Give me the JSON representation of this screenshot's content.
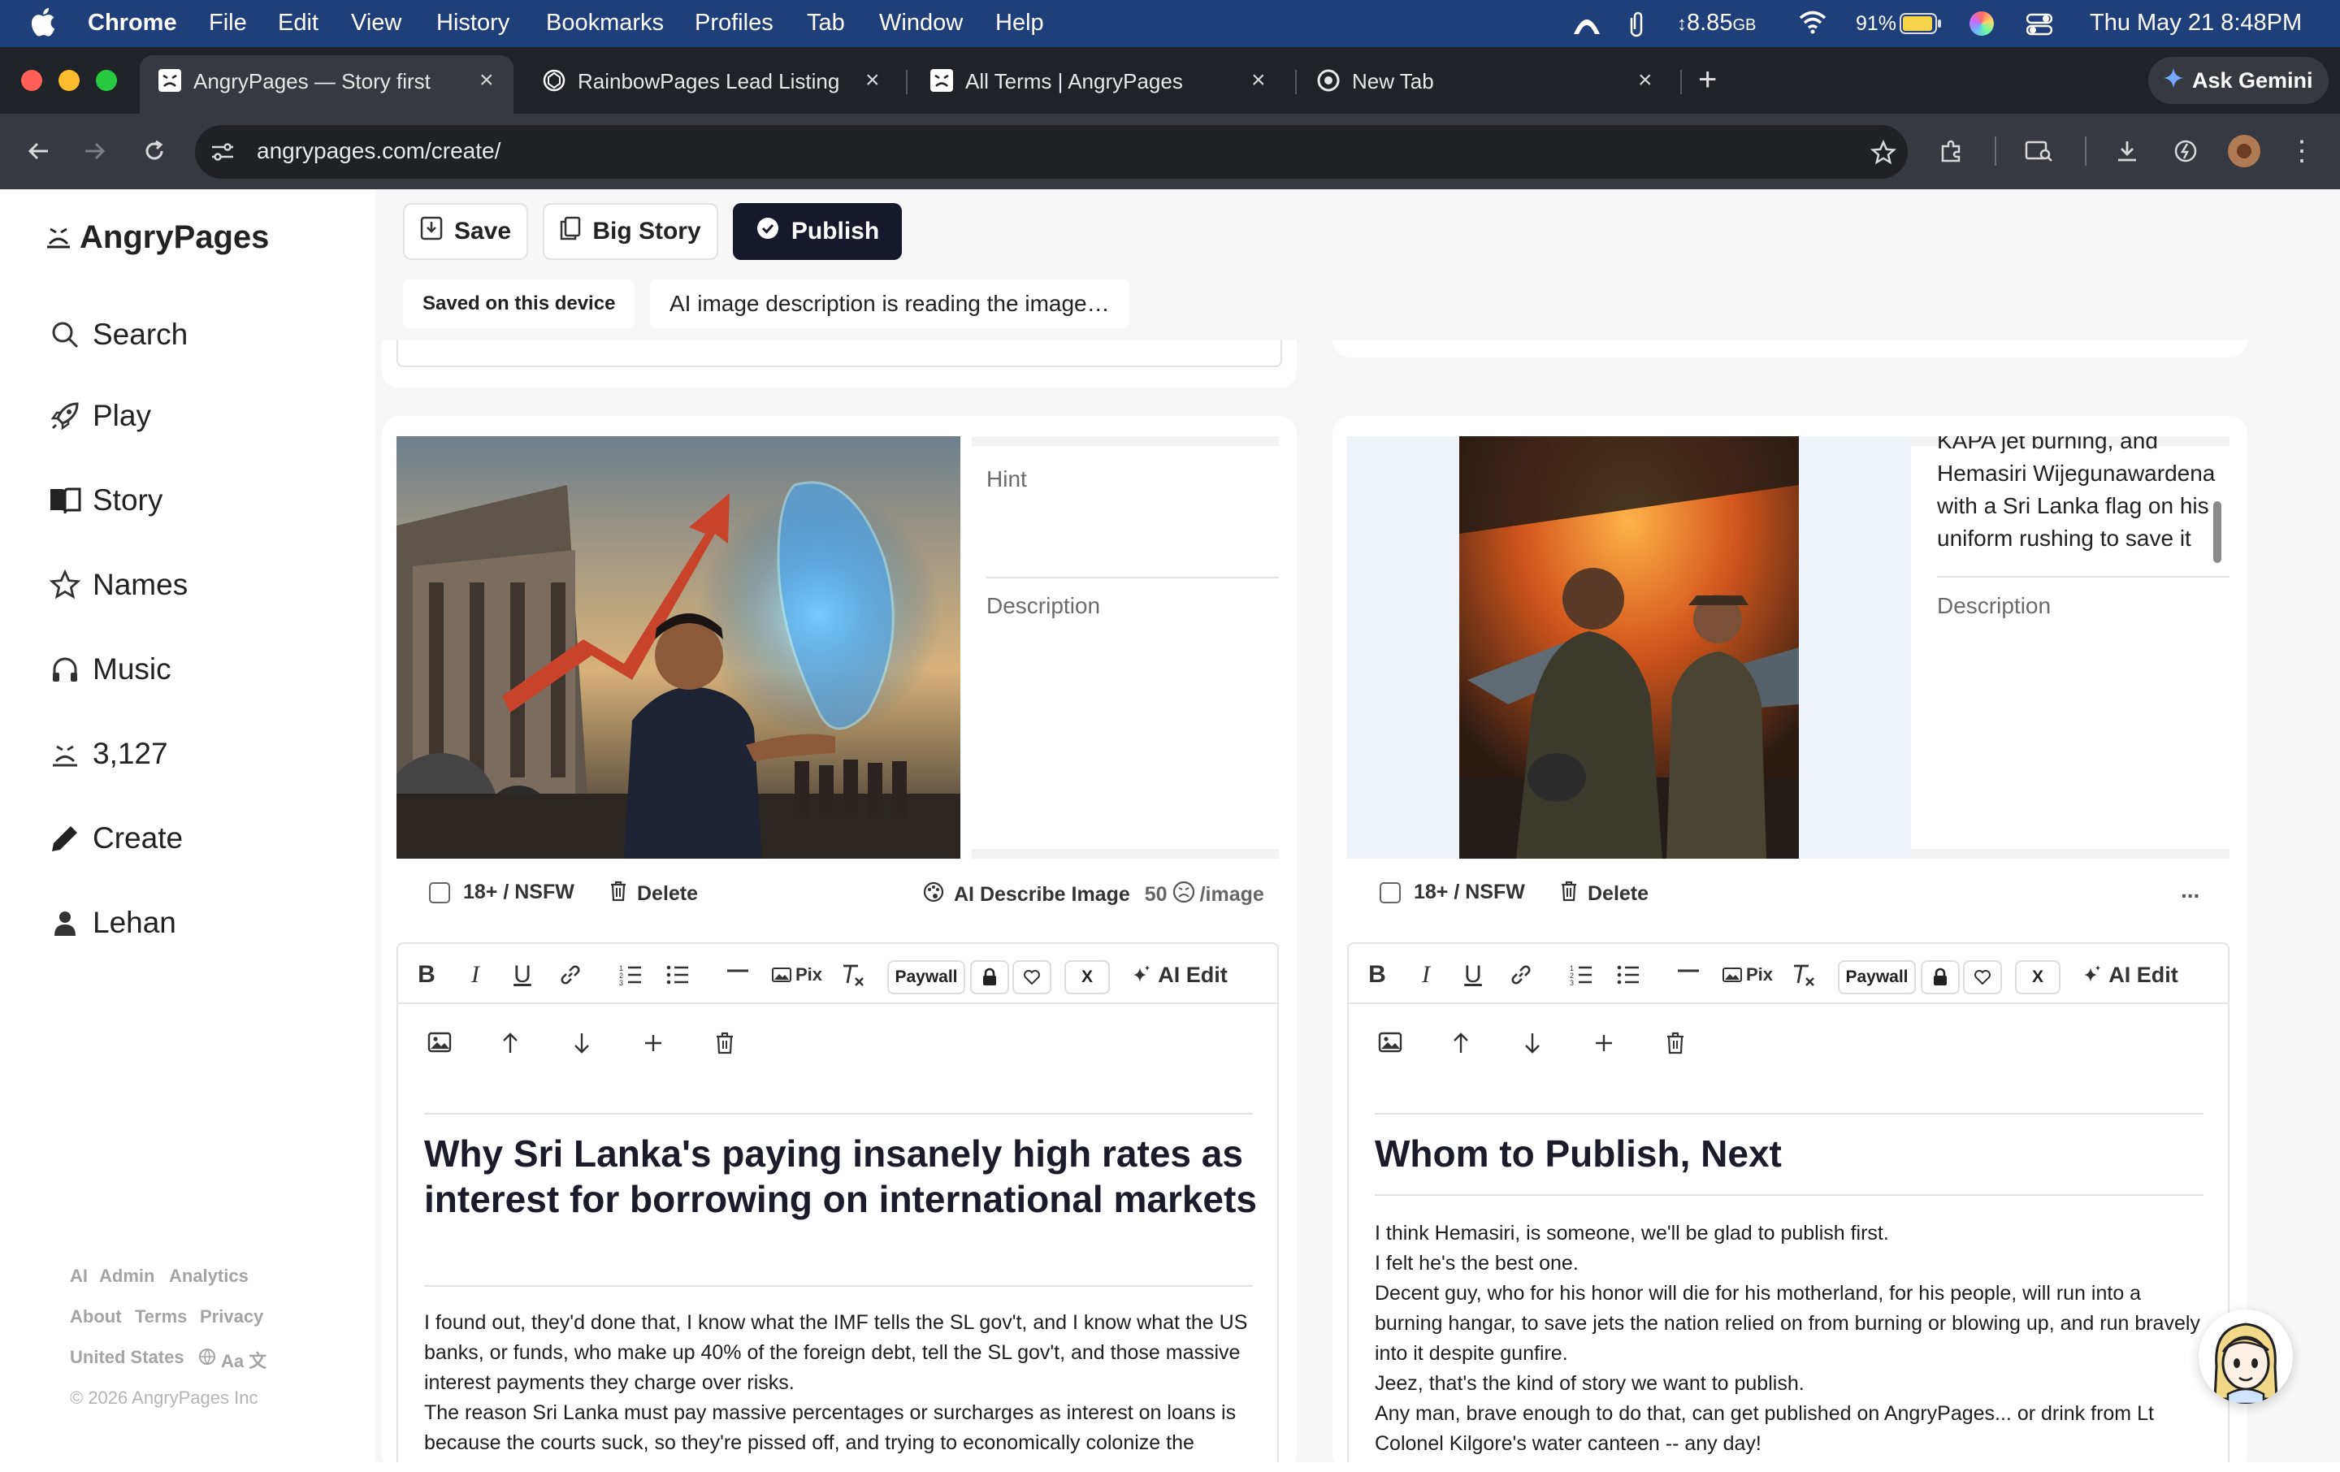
{
  "menubar": {
    "app": "Chrome",
    "items": [
      "File",
      "Edit",
      "View",
      "History",
      "Bookmarks",
      "Profiles",
      "Tab",
      "Window",
      "Help"
    ],
    "storage": "8.85",
    "storage_unit": "GB",
    "battery": "91%",
    "datetime": "Thu May 21  8:48PM"
  },
  "browser": {
    "tabs": [
      {
        "title": "AngryPages — Story first",
        "active": true
      },
      {
        "title": "RainbowPages Lead Listing",
        "active": false
      },
      {
        "title": "All Terms | AngryPages",
        "active": false
      },
      {
        "title": "New Tab",
        "active": false
      }
    ],
    "new_tab": "+",
    "gemini": "Ask Gemini",
    "url": "angrypages.com/create/"
  },
  "sidebar": {
    "brand": "AngryPages",
    "nav": [
      {
        "label": "Search",
        "icon": "search-icon"
      },
      {
        "label": "Play",
        "icon": "rocket-icon"
      },
      {
        "label": "Story",
        "icon": "book-icon"
      },
      {
        "label": "Names",
        "icon": "star-icon"
      },
      {
        "label": "Music",
        "icon": "headphones-icon"
      },
      {
        "label": "3,127",
        "icon": "angry-face-icon"
      },
      {
        "label": "Create",
        "icon": "pencil-icon"
      },
      {
        "label": "Lehan",
        "icon": "user-icon"
      }
    ],
    "footer": {
      "row1": [
        "AI",
        "Admin",
        "Analytics"
      ],
      "row2": [
        "About",
        "Terms",
        "Privacy"
      ],
      "region": "United States",
      "lang": "Aa 文",
      "copyright": "© 2026 AngryPages Inc"
    }
  },
  "actions": {
    "save": "Save",
    "big_story": "Big Story",
    "publish": "Publish",
    "saved_status": "Saved on this device",
    "ai_status": "AI image description is reading the image…"
  },
  "cards": [
    {
      "hint_placeholder": "Hint",
      "hint_value": "",
      "desc_placeholder": "Description",
      "nsfw": "18+ / NSFW",
      "delete": "Delete",
      "ai_describe": "AI Describe Image",
      "ai_cost": "50",
      "ai_cost_unit": "/image",
      "headline": "Why Sri Lanka's paying insanely high rates as interest for borrowing on international markets",
      "body": [
        "I found out, they'd done that, I know what the IMF tells the SL gov't, and I know what the US banks, or funds, who make up 40% of the foreign debt, tell the SL gov't, and those massive interest payments they charge over risks.",
        "The reason Sri Lanka must pay massive percentages or surcharges as interest on loans is because the courts suck, so they're pissed off, and trying to economically colonize the"
      ]
    },
    {
      "hint_lines": [
        "KAPA jet burning, and",
        "Hemasiri Wijegunawardena",
        "with a Sri Lanka flag on his",
        "uniform rushing to save it"
      ],
      "desc_placeholder": "Description",
      "nsfw": "18+ / NSFW",
      "delete": "Delete",
      "more": "...",
      "headline": "Whom to Publish, Next",
      "body": [
        "I think Hemasiri, is someone, we'll be glad to publish first.",
        "I felt he's the best one.",
        "Decent guy, who for his honor will die for his motherland, for his people, will run into a burning hangar, to save jets the nation relied on from burning or blowing up, and run bravely into it despite gunfire.",
        "Jeez, that's the kind of story we want to publish.",
        "Any man, brave enough to do that, can get published on AngryPages... or drink from Lt Colonel Kilgore's water canteen -- any day!"
      ]
    }
  ],
  "editor": {
    "pix": "Pix",
    "paywall": "Paywall",
    "x": "X",
    "ai_edit": "AI Edit"
  },
  "colors": {
    "menubar": "#1f3f7a",
    "chrome_dark": "#1f2328",
    "publish_bg": "#15192a",
    "accent_red": "#ff5f57",
    "accent_yellow": "#febc2e",
    "accent_green": "#28c840"
  }
}
